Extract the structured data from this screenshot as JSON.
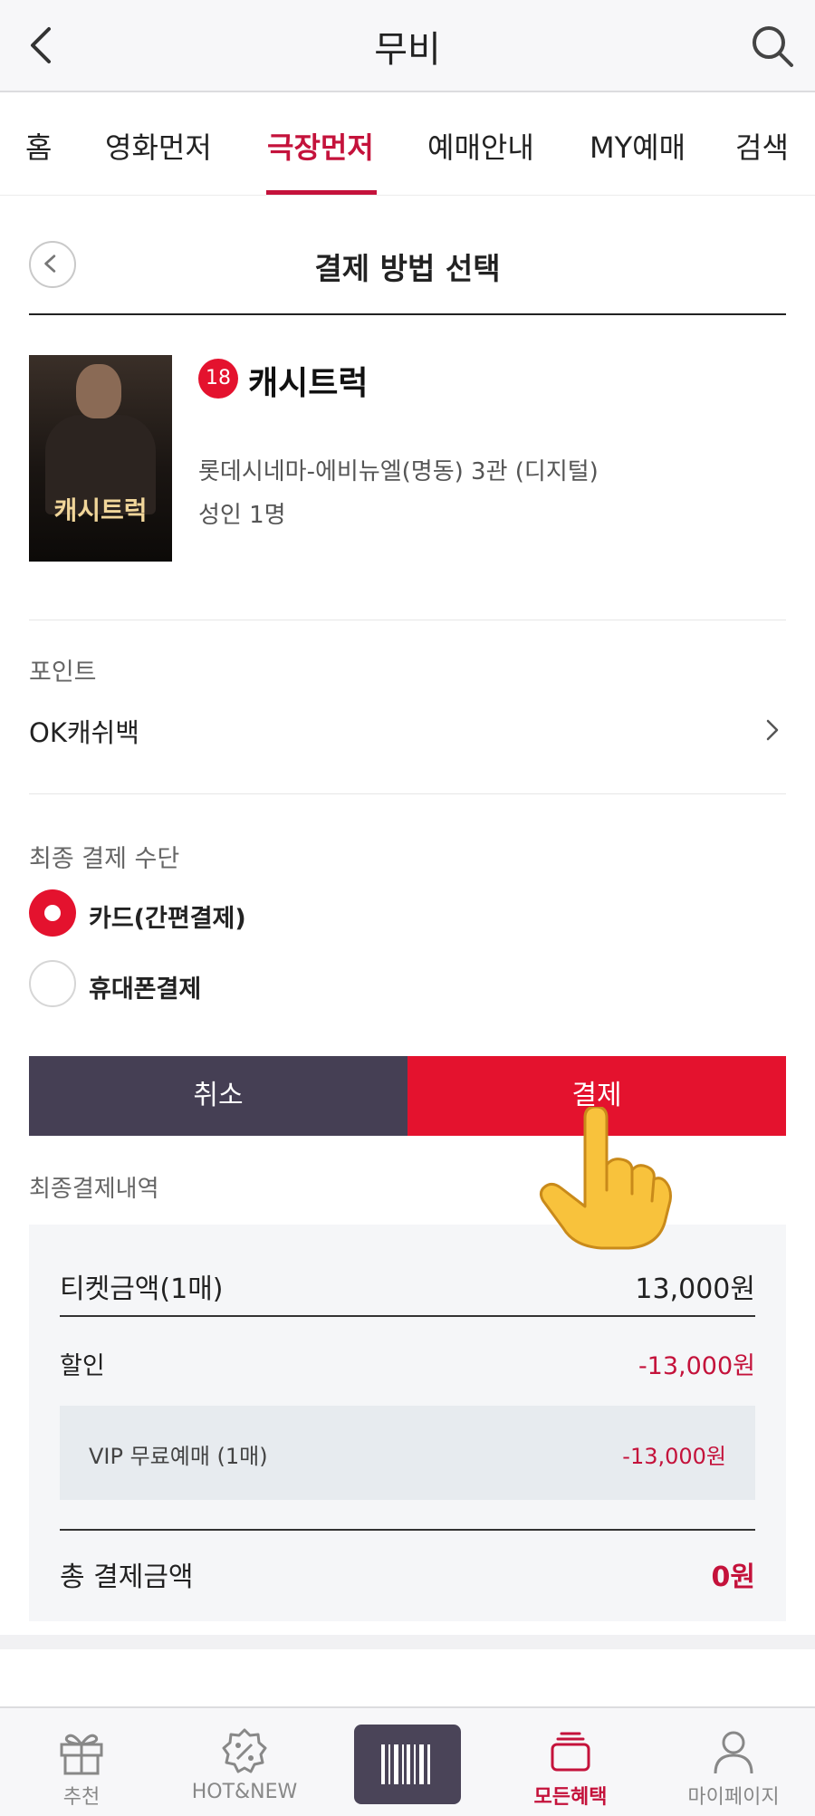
{
  "header": {
    "title": "무비"
  },
  "tabs": [
    {
      "label": "홈"
    },
    {
      "label": "영화먼저"
    },
    {
      "label": "극장먼저",
      "active": true
    },
    {
      "label": "예매안내"
    },
    {
      "label": "MY예매"
    },
    {
      "label": "검색"
    }
  ],
  "section": {
    "title": "결제 방법 선택"
  },
  "movie": {
    "age_rating": "18",
    "title": "캐시트럭",
    "poster_title": "캐시트럭",
    "theater": "롯데시네마-에비뉴엘(명동) 3관 (디지털)",
    "people": "성인 1명"
  },
  "point": {
    "label": "포인트",
    "item": "OK캐쉬백"
  },
  "payment": {
    "label": "최종 결제 수단",
    "options": [
      {
        "label": "카드(간편결제)",
        "selected": true
      },
      {
        "label": "휴대폰결제",
        "selected": false
      }
    ]
  },
  "actions": {
    "cancel": "취소",
    "pay": "결제"
  },
  "summary": {
    "label": "최종결제내역",
    "ticket_label": "티켓금액(1매)",
    "ticket_value": "13,000원",
    "discount_label": "할인",
    "discount_value": "-13,000원",
    "vip_label": "VIP 무료예매 (1매)",
    "vip_value": "-13,000원",
    "total_label": "총 결제금액",
    "total_value": "0원"
  },
  "bottom_nav": [
    {
      "label": "추천",
      "icon": "gift-icon"
    },
    {
      "label": "HOT&NEW",
      "icon": "percent-badge-icon"
    },
    {
      "label": "",
      "icon": "barcode-icon"
    },
    {
      "label": "모든혜택",
      "icon": "wallet-icon",
      "active": true
    },
    {
      "label": "마이페이지",
      "icon": "person-icon"
    }
  ],
  "colors": {
    "accent": "#e4122e",
    "accent_text": "#c4123b",
    "dark_button": "#453f54"
  }
}
